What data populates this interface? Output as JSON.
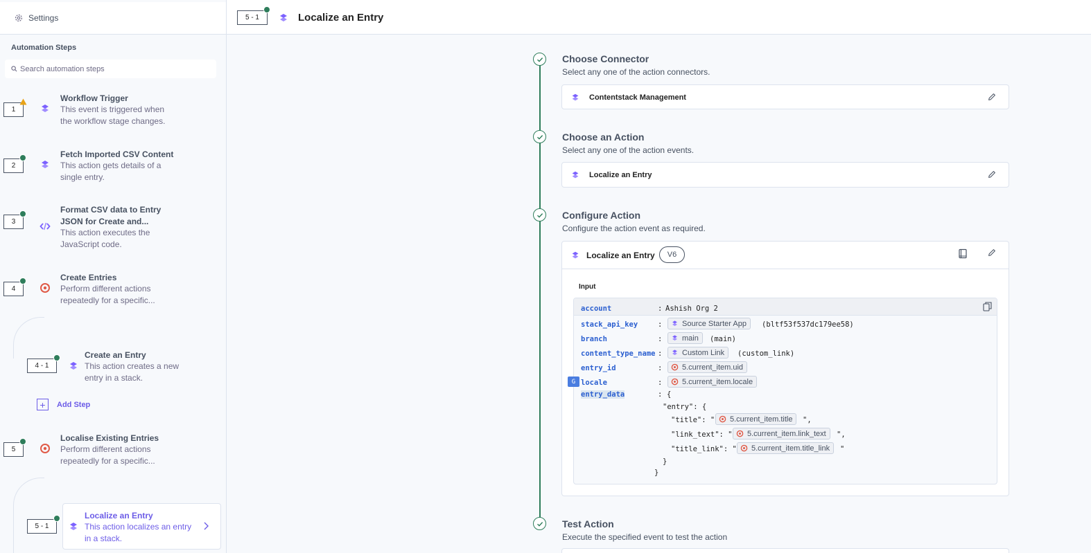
{
  "sidebar": {
    "settings_label": "Settings",
    "steps_title": "Automation Steps",
    "search_placeholder": "Search automation steps",
    "add_step_label": "Add Step",
    "steps": [
      {
        "num": "1",
        "title": "Workflow Trigger",
        "desc": "This event is triggered when the workflow stage changes.",
        "status": "warning",
        "icon": "connector-icon"
      },
      {
        "num": "2",
        "title": "Fetch Imported CSV Content",
        "desc": "This action gets details of a single entry.",
        "status": "success",
        "icon": "connector-icon"
      },
      {
        "num": "3",
        "title": "Format CSV data to Entry JSON for Create and...",
        "desc": "This action executes the JavaScript code.",
        "status": "success",
        "icon": "code-icon"
      },
      {
        "num": "4",
        "title": "Create Entries",
        "desc": "Perform different actions repeatedly for a specific...",
        "status": "success",
        "icon": "repeat-icon"
      },
      {
        "num": "4 - 1",
        "title": "Create an Entry",
        "desc": "This action creates a new entry in a stack.",
        "status": "success",
        "icon": "connector-icon"
      },
      {
        "num": "5",
        "title": "Localise Existing Entries",
        "desc": "Perform different actions repeatedly for a specific...",
        "status": "success",
        "icon": "repeat-icon"
      },
      {
        "num": "5 - 1",
        "title": "Localize an Entry",
        "desc": "This action localizes an entry in a stack.",
        "status": "success",
        "icon": "connector-icon",
        "active": true
      }
    ]
  },
  "header": {
    "num": "5 - 1",
    "title": "Localize an Entry"
  },
  "sections": {
    "connector": {
      "title": "Choose Connector",
      "subtitle": "Select any one of the action connectors.",
      "value": "Contentstack Management"
    },
    "action": {
      "title": "Choose an Action",
      "subtitle": "Select any one of the action events.",
      "value": "Localize an Entry"
    },
    "configure": {
      "title": "Configure Action",
      "subtitle": "Configure the action event as required.",
      "card_title": "Localize an Entry",
      "version": "V6",
      "input_label": "Input"
    },
    "test": {
      "title": "Test Action",
      "subtitle": "Execute the specified event to test the action"
    }
  },
  "input": {
    "account": {
      "key": "account",
      "value": "Ashish Org 2"
    },
    "stack_api_key": {
      "key": "stack_api_key",
      "chip": "Source Starter App",
      "suffix": "(bltf53f537dc179ee58)"
    },
    "branch": {
      "key": "branch",
      "chip": "main",
      "suffix": "(main)"
    },
    "content_type_name": {
      "key": "content_type_name",
      "chip": "Custom Link",
      "suffix": "(custom_link)"
    },
    "entry_id": {
      "key": "entry_id",
      "chip": "5.current_item.uid"
    },
    "locale": {
      "key": "locale",
      "chip": "5.current_item.locale"
    },
    "entry_data": {
      "key": "entry_data",
      "open": "{",
      "entry_open": "\"entry\": {",
      "title_key": "\"title\": \"",
      "title_chip": "5.current_item.title",
      "title_end": "\",",
      "link_text_key": "\"link_text\": \"",
      "link_text_chip": "5.current_item.link_text",
      "link_text_end": "\",",
      "title_link_key": "\"title_link\": \"",
      "title_link_chip": "5.current_item.title_link",
      "title_link_end": "\"",
      "entry_close": "}",
      "close": "}"
    },
    "colon": ":"
  },
  "colors": {
    "accent": "#6c5ce7",
    "success": "#2e7d5b",
    "warning": "#e8a317",
    "repeat": "#e05a47",
    "key": "#2b5fd0"
  }
}
